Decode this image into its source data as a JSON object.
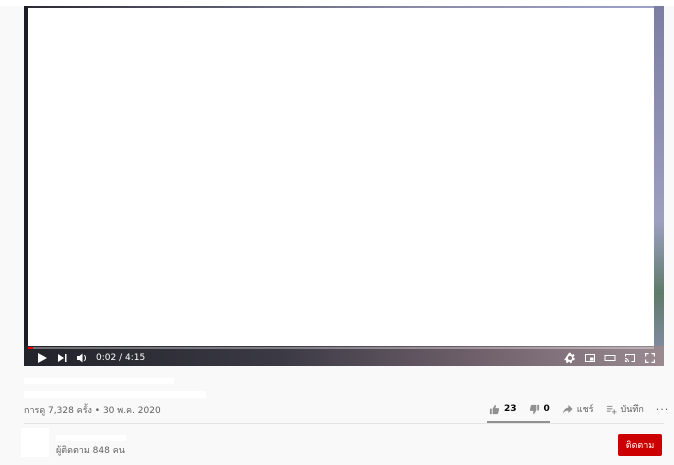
{
  "player": {
    "time_display": "0:02 / 4:15",
    "progress_fraction": 0.008,
    "accent_color": "#ff0000",
    "controls": [
      "play-icon",
      "next-icon",
      "volume-icon",
      "settings-icon",
      "miniplayer-icon",
      "theater-icon",
      "cast-icon",
      "fullscreen-icon"
    ]
  },
  "video": {
    "stats": "การดู 7,328 ครั้ง • 30 พ.ค. 2020"
  },
  "actions": {
    "like_count": "23",
    "dislike_count": "0",
    "share_label": "แชร์",
    "save_label": "บันทึก",
    "more_label": "···"
  },
  "channel": {
    "subscribers": "ผู้ติดตาม 848 คน",
    "subscribe_label": "ติดตาม",
    "subscribe_color": "#cc0000"
  }
}
